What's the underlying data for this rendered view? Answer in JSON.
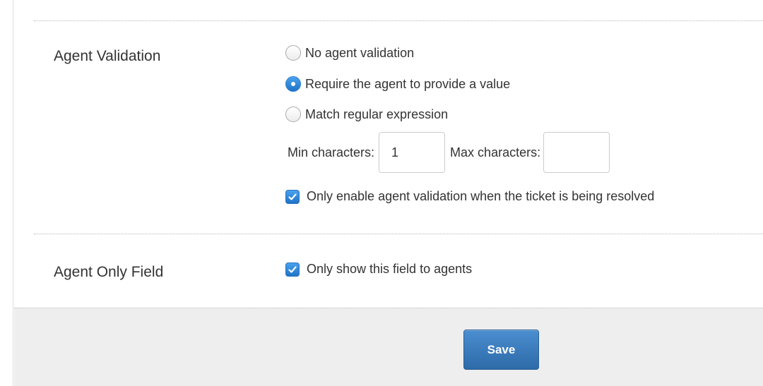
{
  "sections": {
    "validation": {
      "label": "Agent Validation",
      "options": [
        {
          "label": "No agent validation",
          "checked": false
        },
        {
          "label": "Require the agent to provide a value",
          "checked": true
        },
        {
          "label": "Match regular expression",
          "checked": false
        }
      ],
      "min_label": "Min characters:",
      "min_value": "1",
      "max_label": "Max characters:",
      "max_value": "",
      "only_resolved_label": "Only enable agent validation when the ticket is being resolved",
      "only_resolved_checked": true
    },
    "agent_only": {
      "label": "Agent Only Field",
      "checkbox_label": "Only show this field to agents",
      "checked": true
    }
  },
  "footer": {
    "save_label": "Save"
  },
  "colors": {
    "accent": "#1f73c7",
    "button": "#2d6aa8",
    "footer_bg": "#eeeeee"
  }
}
